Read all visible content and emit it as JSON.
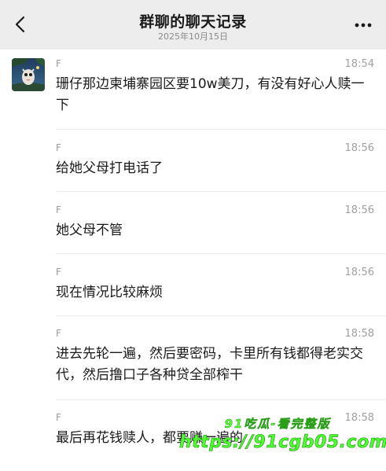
{
  "header": {
    "title": "群聊的聊天记录",
    "date": "2025年10月15日",
    "back_icon": "chevron-left-icon",
    "more_icon": "more-dots-icon"
  },
  "messages": [
    {
      "sender": "F",
      "time": "18:54",
      "text": "珊仔那边柬埔寨园区要10w美刀，有没有好心人赎一下"
    },
    {
      "sender": "F",
      "time": "18:56",
      "text": "给她父母打电话了"
    },
    {
      "sender": "F",
      "time": "18:56",
      "text": "她父母不管"
    },
    {
      "sender": "F",
      "time": "18:56",
      "text": "现在情况比较麻烦"
    },
    {
      "sender": "F",
      "time": "18:58",
      "text": "进去先轮一遍，然后要密码，卡里所有钱都得老实交代，然后撸口子各种贷全部榨干"
    },
    {
      "sender": "F",
      "time": "18:58",
      "text": "最后再花钱赎人，都要赚一遍的"
    }
  ],
  "watermark": {
    "line1": "91吃瓜-看完整版",
    "line2": "https://91cgb05.com"
  }
}
